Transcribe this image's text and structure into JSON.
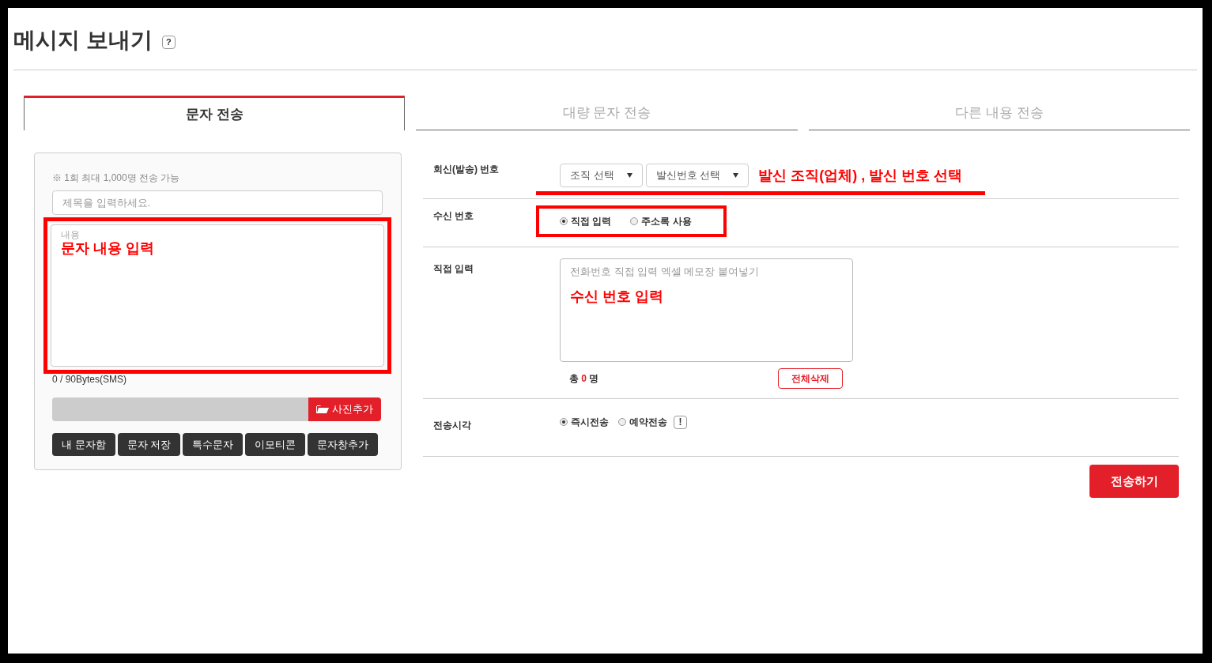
{
  "page": {
    "title": "메시지 보내기",
    "help": "?"
  },
  "tabs": [
    {
      "label": "문자 전송",
      "selected": true
    },
    {
      "label": "대량 문자 전송",
      "selected": false
    },
    {
      "label": "다른 내용 전송",
      "selected": false
    }
  ],
  "compose": {
    "notice": "※ 1회 최대 1,000명 전송 가능",
    "subject": {
      "placeholder": "제목을 입력하세요."
    },
    "body": {
      "placeholder": "내용",
      "annotation": {
        "kind": "box",
        "text": "문자 내용 입력"
      }
    },
    "byte_count": "0 / 90Bytes(SMS)",
    "photo_button": "사진추가",
    "buttons": [
      "내 문자함",
      "문자 저장",
      "특수문자",
      "이모티콘",
      "문자창추가"
    ]
  },
  "form": {
    "rows": [
      {
        "kind": "sender",
        "label": "회신(발송) 번호",
        "selects": [
          "조직 선택",
          "발신번호 선택"
        ],
        "annotation": {
          "kind": "underline",
          "text": "발신 조직(업체) , 발신 번호 선택"
        }
      },
      {
        "kind": "radio",
        "label": "수신 번호",
        "options": [
          {
            "label": "직접 입력",
            "selected": true
          },
          {
            "label": "주소록 사용",
            "selected": false
          }
        ],
        "annotation": {
          "kind": "box"
        }
      },
      {
        "kind": "textarea",
        "label": "직접 입력",
        "placeholder": "전화번호 직접 입력 엑셀 메모장 붙여넣기",
        "total_prefix": "총",
        "count": "0",
        "total_suffix": "명",
        "clear_button": "전체삭제",
        "annotation": {
          "kind": "note",
          "text": "수신 번호 입력"
        }
      },
      {
        "kind": "radio",
        "label": "전송시각",
        "options": [
          {
            "label": "즉시전송",
            "selected": true
          },
          {
            "label": "예약전송",
            "selected": false
          }
        ],
        "info": "!"
      }
    ]
  },
  "submit": "전송하기"
}
